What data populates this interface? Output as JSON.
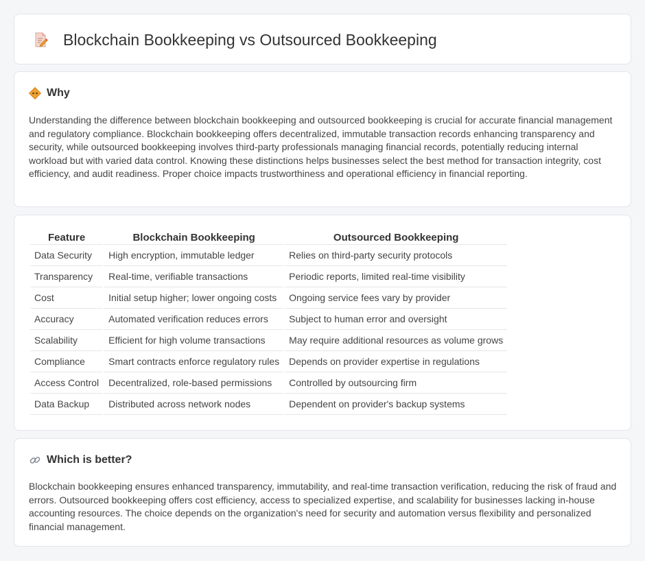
{
  "header": {
    "title": "Blockchain Bookkeeping vs Outsourced Bookkeeping",
    "icon": "document-edit-icon"
  },
  "why": {
    "heading": "Why",
    "icon": "diamond-sign-icon",
    "text": "Understanding the difference between blockchain bookkeeping and outsourced bookkeeping is crucial for accurate financial management and regulatory compliance. Blockchain bookkeeping offers decentralized, immutable transaction records enhancing transparency and security, while outsourced bookkeeping involves third-party professionals managing financial records, potentially reducing internal workload but with varied data control. Knowing these distinctions helps businesses select the best method for transaction integrity, cost efficiency, and audit readiness. Proper choice impacts trustworthiness and operational efficiency in financial reporting."
  },
  "table": {
    "headers": [
      "Feature",
      "Blockchain Bookkeeping",
      "Outsourced Bookkeeping"
    ],
    "rows": [
      [
        "Data Security",
        "High encryption, immutable ledger",
        "Relies on third-party security protocols"
      ],
      [
        "Transparency",
        "Real-time, verifiable transactions",
        "Periodic reports, limited real-time visibility"
      ],
      [
        "Cost",
        "Initial setup higher; lower ongoing costs",
        "Ongoing service fees vary by provider"
      ],
      [
        "Accuracy",
        "Automated verification reduces errors",
        "Subject to human error and oversight"
      ],
      [
        "Scalability",
        "Efficient for high volume transactions",
        "May require additional resources as volume grows"
      ],
      [
        "Compliance",
        "Smart contracts enforce regulatory rules",
        "Depends on provider expertise in regulations"
      ],
      [
        "Access Control",
        "Decentralized, role-based permissions",
        "Controlled by outsourcing firm"
      ],
      [
        "Data Backup",
        "Distributed across network nodes",
        "Dependent on provider's backup systems"
      ]
    ]
  },
  "better": {
    "heading": "Which is better?",
    "icon": "link-icon",
    "text": "Blockchain bookkeeping ensures enhanced transparency, immutability, and real-time transaction verification, reducing the risk of fraud and errors. Outsourced bookkeeping offers cost efficiency, access to specialized expertise, and scalability for businesses lacking in-house accounting resources. The choice depends on the organization's need for security and automation versus flexibility and personalized financial management."
  },
  "colors": {
    "background": "#f5f6f8",
    "card": "#ffffff",
    "border": "#e3e5ea",
    "accent": "#f0a030"
  }
}
